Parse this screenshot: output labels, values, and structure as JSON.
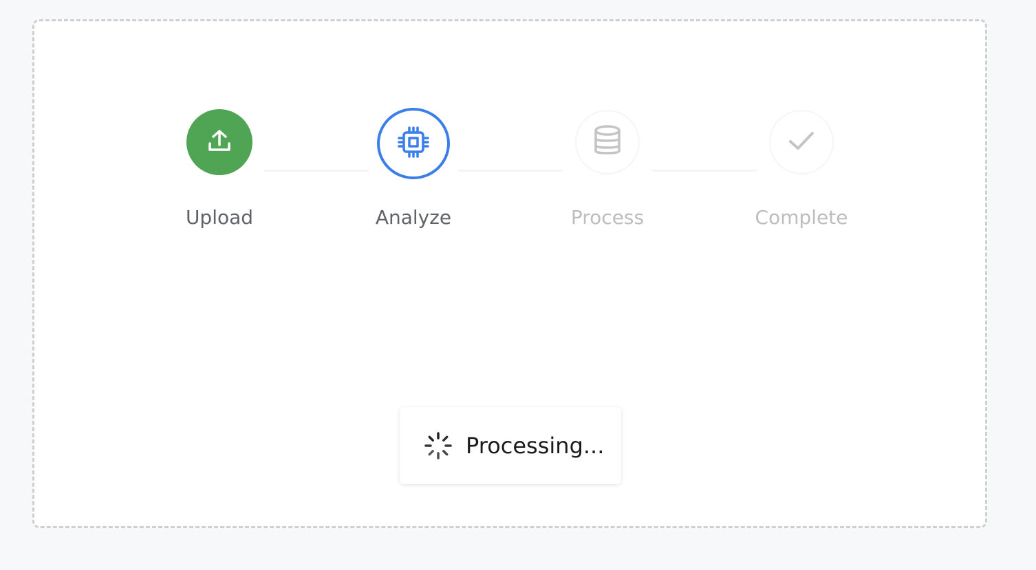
{
  "steps": [
    {
      "label": "Upload",
      "state": "done",
      "icon": "upload-icon"
    },
    {
      "label": "Analyze",
      "state": "active",
      "icon": "cpu-icon"
    },
    {
      "label": "Process",
      "state": "pending",
      "icon": "database-icon"
    },
    {
      "label": "Complete",
      "state": "pending",
      "icon": "check-icon"
    }
  ],
  "status": {
    "text": "Processing...",
    "icon": "spinner-icon"
  },
  "colors": {
    "done": "#4fa553",
    "active": "#3a7eea",
    "pending_icon": "#c4c4c4",
    "done_label": "#5f6368",
    "pending_label": "#bdbdbd"
  }
}
